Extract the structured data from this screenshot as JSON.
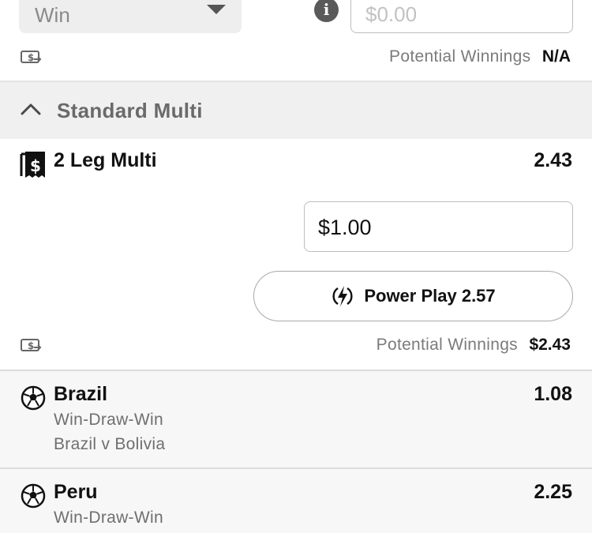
{
  "top_bet": {
    "bet_type_selected": "Win",
    "stake_placeholder": "$0.00",
    "potential_winnings_label": "Potential Winnings",
    "potential_winnings_value": "N/A"
  },
  "section": {
    "title": "Standard Multi"
  },
  "multi": {
    "title": "2 Leg Multi",
    "odds": "2.43",
    "stake_value": "$1.00",
    "power_play_label": "Power Play 2.57",
    "potential_winnings_label": "Potential Winnings",
    "potential_winnings_value": "$2.43"
  },
  "legs": [
    {
      "selection": "Brazil",
      "odds": "1.08",
      "market": "Win-Draw-Win",
      "event": "Brazil v Bolivia"
    },
    {
      "selection": "Peru",
      "odds": "2.25",
      "market": "Win-Draw-Win"
    }
  ],
  "icons": {
    "info": "info-icon",
    "cash": "cash-out-icon",
    "chevron": "chevron-up-icon",
    "receipt": "receipt-icon",
    "bolt": "lightning-bolt-icon",
    "ball": "soccer-ball-icon"
  },
  "colors": {
    "section_bg": "#f0f0f0",
    "leg_bg": "#f7f7f7",
    "muted_text": "#7b7b7b"
  }
}
